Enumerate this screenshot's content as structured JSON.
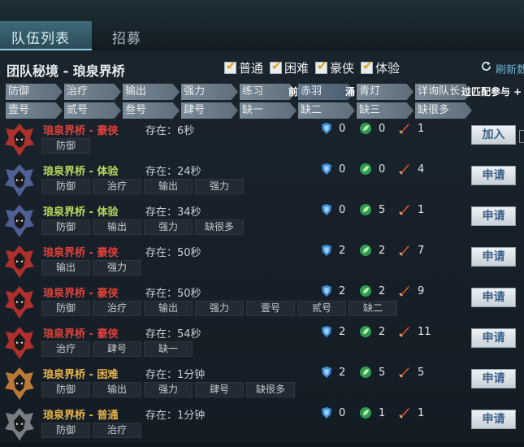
{
  "tabs": {
    "active": "队伍列表",
    "inactive": "招募"
  },
  "title": "团队秘境 - 琅泉界桥",
  "difficulty_filters": [
    {
      "label": "普通",
      "checked": true
    },
    {
      "label": "困难",
      "checked": true
    },
    {
      "label": "豪侠",
      "checked": true
    },
    {
      "label": "体验",
      "checked": true
    }
  ],
  "refresh_label": "刷新数",
  "filter_row1": [
    "防御",
    "治疗",
    "输出",
    "强力",
    "练习",
    "赤羽",
    "青灯",
    "详询队长"
  ],
  "filter_row2": [
    "壹号",
    "贰号",
    "叁号",
    "肆号",
    "缺一",
    "缺二",
    "缺三",
    "缺很多"
  ],
  "overlay_texts": {
    "left": "前",
    "mid": "涌",
    "right": "过匹配参与 +"
  },
  "colors": {
    "hard": "#e0403a",
    "trial": "#b5d95a",
    "difficult": "#e8b24a",
    "normal": "#e8b24a"
  },
  "teams": [
    {
      "name": "琅泉界桥 - 豪侠",
      "mode": "hard",
      "exist": "存在：6秒",
      "tags": [
        "防御"
      ],
      "shield": 0,
      "heal": 0,
      "dps": 1,
      "action": "加入"
    },
    {
      "name": "琅泉界桥 - 体验",
      "mode": "trial",
      "exist": "存在：24秒",
      "tags": [
        "防御",
        "治疗",
        "输出",
        "强力"
      ],
      "shield": 0,
      "heal": 0,
      "dps": 4,
      "action": "申请"
    },
    {
      "name": "琅泉界桥 - 体验",
      "mode": "trial",
      "exist": "存在：34秒",
      "tags": [
        "防御",
        "输出",
        "强力",
        "缺很多"
      ],
      "shield": 0,
      "heal": 5,
      "dps": 1,
      "action": "申请"
    },
    {
      "name": "琅泉界桥 - 豪侠",
      "mode": "hard",
      "exist": "存在：50秒",
      "tags": [
        "输出",
        "强力"
      ],
      "shield": 2,
      "heal": 2,
      "dps": 7,
      "action": "申请"
    },
    {
      "name": "琅泉界桥 - 豪侠",
      "mode": "hard",
      "exist": "存在：50秒",
      "tags": [
        "防御",
        "治疗",
        "输出",
        "强力",
        "壹号",
        "贰号",
        "缺二"
      ],
      "shield": 2,
      "heal": 2,
      "dps": 9,
      "action": "申请"
    },
    {
      "name": "琅泉界桥 - 豪侠",
      "mode": "hard",
      "exist": "存在：54秒",
      "tags": [
        "治疗",
        "肆号",
        "缺一"
      ],
      "shield": 2,
      "heal": 2,
      "dps": 11,
      "action": "申请"
    },
    {
      "name": "琅泉界桥 - 困难",
      "mode": "difficult",
      "exist": "存在：1分钟",
      "tags": [
        "防御",
        "输出",
        "强力",
        "肆号",
        "缺很多"
      ],
      "shield": 2,
      "heal": 5,
      "dps": 5,
      "action": "申请"
    },
    {
      "name": "琅泉界桥 - 普通",
      "mode": "normal",
      "exist": "存在：1分钟",
      "tags": [
        "防御",
        "治疗"
      ],
      "shield": 0,
      "heal": 1,
      "dps": 1,
      "action": "申请"
    }
  ]
}
